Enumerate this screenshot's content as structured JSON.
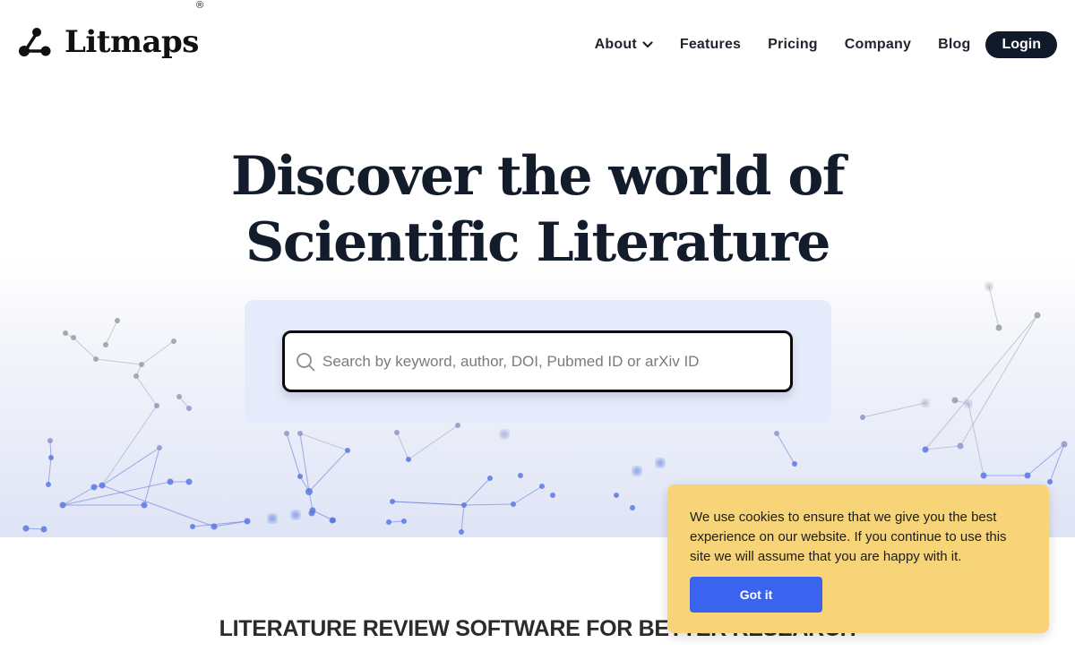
{
  "brand": {
    "name": "Litmaps",
    "registered_mark": "®",
    "logo_icon": "network-nodes-icon"
  },
  "nav": {
    "items": [
      {
        "label": "About",
        "has_dropdown": true
      },
      {
        "label": "Features"
      },
      {
        "label": "Pricing"
      },
      {
        "label": "Company"
      },
      {
        "label": "Blog"
      }
    ],
    "login_label": "Login"
  },
  "hero": {
    "title_line1": "Discover the world of",
    "title_line2": "Scientific Literature",
    "search": {
      "icon": "search-icon",
      "value": "",
      "placeholder": "Search by keyword, author, DOI, Pubmed ID or arXiv ID"
    }
  },
  "section": {
    "tagline": "LITERATURE REVIEW SOFTWARE FOR BETTER RESEARCH"
  },
  "cookie_banner": {
    "message": "We use cookies to ensure that we give you the best experience on our website. If you continue to use this site we will assume that you are happy with it.",
    "accept_label": "Got it"
  },
  "colors": {
    "login_bg": "#111a2b",
    "title": "#131c2b",
    "search_panel": "#e6ebfb",
    "cookie_bg": "#f6d477",
    "cookie_button": "#3a63f0",
    "network_blue": "#5a78e0",
    "network_gray": "#9a9ca6"
  }
}
